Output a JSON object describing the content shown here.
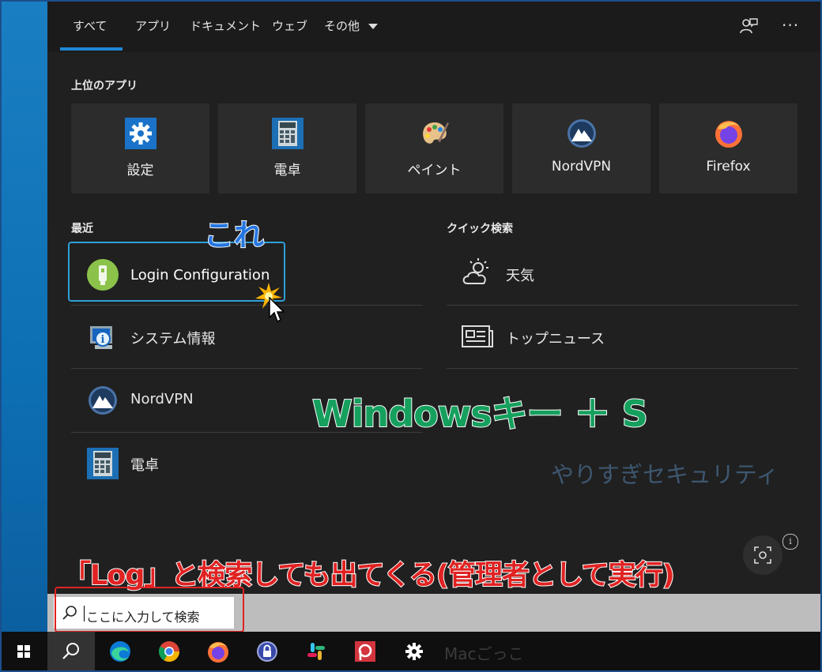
{
  "tabs": [
    {
      "label": "すべて",
      "active": true
    },
    {
      "label": "アプリ"
    },
    {
      "label": "ドキュメント"
    },
    {
      "label": "ウェブ"
    },
    {
      "label": "その他"
    }
  ],
  "header_icons": {
    "feedback": "feedback-icon",
    "more": "···"
  },
  "top_apps": {
    "title": "上位のアプリ",
    "items": [
      {
        "label": "設定",
        "icon": "gear-icon"
      },
      {
        "label": "電卓",
        "icon": "calculator-icon"
      },
      {
        "label": "ペイント",
        "icon": "paint-palette-icon"
      },
      {
        "label": "NordVPN",
        "icon": "nordvpn-icon"
      },
      {
        "label": "Firefox",
        "icon": "firefox-icon"
      }
    ]
  },
  "recent": {
    "title": "最近",
    "items": [
      {
        "label": "Login Configuration",
        "icon": "usb-key-icon",
        "selected": true
      },
      {
        "label": "システム情報",
        "icon": "system-info-icon"
      },
      {
        "label": "NordVPN",
        "icon": "nordvpn-icon"
      },
      {
        "label": "電卓",
        "icon": "calculator-icon"
      }
    ]
  },
  "quick_search": {
    "title": "クイック検索",
    "items": [
      {
        "label": "天気",
        "icon": "weather-icon"
      },
      {
        "label": "トップニュース",
        "icon": "news-icon"
      }
    ]
  },
  "annotations": {
    "kore": "これ",
    "shortcut": "Windowsキー ＋ S",
    "log_note": "「Log」と検索しても出てくる(管理者として実行)",
    "watermark": "やりすぎセキュリティ",
    "taskbar_watermark": "Macごっこ"
  },
  "search": {
    "placeholder": "ここに入力して検索"
  },
  "info_label": "i",
  "colors": {
    "accent": "#1e88d6",
    "annotation_red": "#e02222",
    "annotation_green": "#16a05e",
    "annotation_blue": "#2576e0"
  },
  "taskbar": [
    {
      "name": "windows-start-icon"
    },
    {
      "name": "search-icon",
      "active": true
    },
    {
      "name": "edge-icon"
    },
    {
      "name": "chrome-icon"
    },
    {
      "name": "firefox-icon"
    },
    {
      "name": "lock-app-icon"
    },
    {
      "name": "slack-icon"
    },
    {
      "name": "pocket-icon"
    },
    {
      "name": "settings-gear-icon"
    }
  ]
}
